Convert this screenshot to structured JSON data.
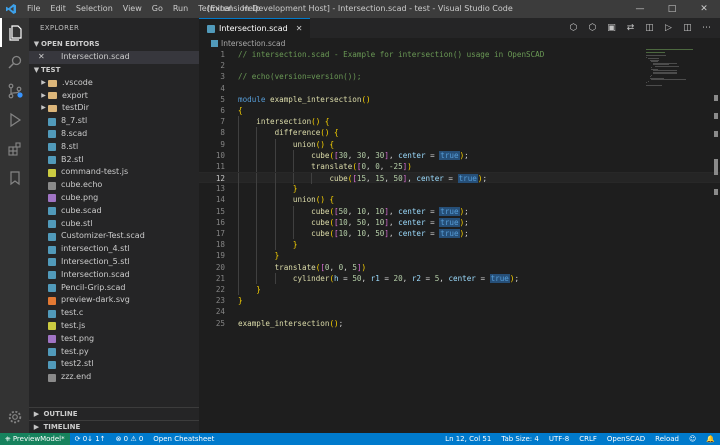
{
  "window": {
    "title": "[Extension Development Host] - Intersection.scad - test - Visual Studio Code",
    "menu": [
      "File",
      "Edit",
      "Selection",
      "View",
      "Go",
      "Run",
      "Terminal",
      "Help"
    ]
  },
  "sidebar": {
    "title": "EXPLORER",
    "open_editors_label": "OPEN EDITORS",
    "open_editors": [
      {
        "name": "Intersection.scad"
      }
    ],
    "workspace_label": "TEST",
    "tree": [
      {
        "name": ".vscode",
        "kind": "folder"
      },
      {
        "name": "export",
        "kind": "folder"
      },
      {
        "name": "testDir",
        "kind": "folder"
      },
      {
        "name": "8_7.stl",
        "kind": "stl"
      },
      {
        "name": "8.scad",
        "kind": "scad"
      },
      {
        "name": "8.stl",
        "kind": "stl"
      },
      {
        "name": "B2.stl",
        "kind": "stl"
      },
      {
        "name": "command-test.js",
        "kind": "js"
      },
      {
        "name": "cube.echo",
        "kind": "text"
      },
      {
        "name": "cube.png",
        "kind": "image"
      },
      {
        "name": "cube.scad",
        "kind": "scad"
      },
      {
        "name": "cube.stl",
        "kind": "stl"
      },
      {
        "name": "Customizer-Test.scad",
        "kind": "scad"
      },
      {
        "name": "intersection_4.stl",
        "kind": "stl"
      },
      {
        "name": "Intersection_5.stl",
        "kind": "stl"
      },
      {
        "name": "Intersection.scad",
        "kind": "scad"
      },
      {
        "name": "Pencil-Grip.scad",
        "kind": "scad"
      },
      {
        "name": "preview-dark.svg",
        "kind": "svg"
      },
      {
        "name": "test.c",
        "kind": "c"
      },
      {
        "name": "test.js",
        "kind": "js"
      },
      {
        "name": "test.png",
        "kind": "image"
      },
      {
        "name": "test.py",
        "kind": "py"
      },
      {
        "name": "test2.stl",
        "kind": "stl"
      },
      {
        "name": "zzz.end",
        "kind": "text"
      }
    ],
    "outline_label": "OUTLINE",
    "timeline_label": "TIMELINE"
  },
  "editor": {
    "tab_label": "Intersection.scad",
    "breadcrumb": "Intersection.scad",
    "current_line": 12,
    "lines": [
      "// intersection.scad - Example for intersection() usage in OpenSCAD",
      "",
      "// echo(version=version());",
      "",
      "module example_intersection()",
      "{",
      "    intersection() {",
      "        difference() {",
      "            union() {",
      "                cube([30, 30, 30], center = true);",
      "                translate([0, 0, -25])",
      "                    cube([15, 15, 50], center = true);",
      "            }",
      "            union() {",
      "                cube([50, 10, 10], center = true);",
      "                cube([10, 50, 10], center = true);",
      "                cube([10, 10, 50], center = true);",
      "            }",
      "        }",
      "        translate([0, 0, 5])",
      "            cylinder(h = 50, r1 = 20, r2 = 5, center = true);",
      "    }",
      "}",
      "",
      "example_intersection();"
    ]
  },
  "statusbar": {
    "remote": "PreviewModel*",
    "sync": "0↓ 1↑",
    "problems": "0 ⚠ 0",
    "cheatsheet": "Open Cheatsheet",
    "position": "Ln 12, Col 51",
    "tab_size": "Tab Size: 4",
    "encoding": "UTF-8",
    "eol": "CRLF",
    "language": "OpenSCAD",
    "reload": "Reload"
  },
  "colors": {
    "accent": "#007acc",
    "remote": "#16825d",
    "comment": "#6a9955",
    "keyword": "#c586c0",
    "function": "#dcdcaa",
    "number": "#b5cea8",
    "variable": "#9cdcfe",
    "constant": "#569cd6"
  }
}
